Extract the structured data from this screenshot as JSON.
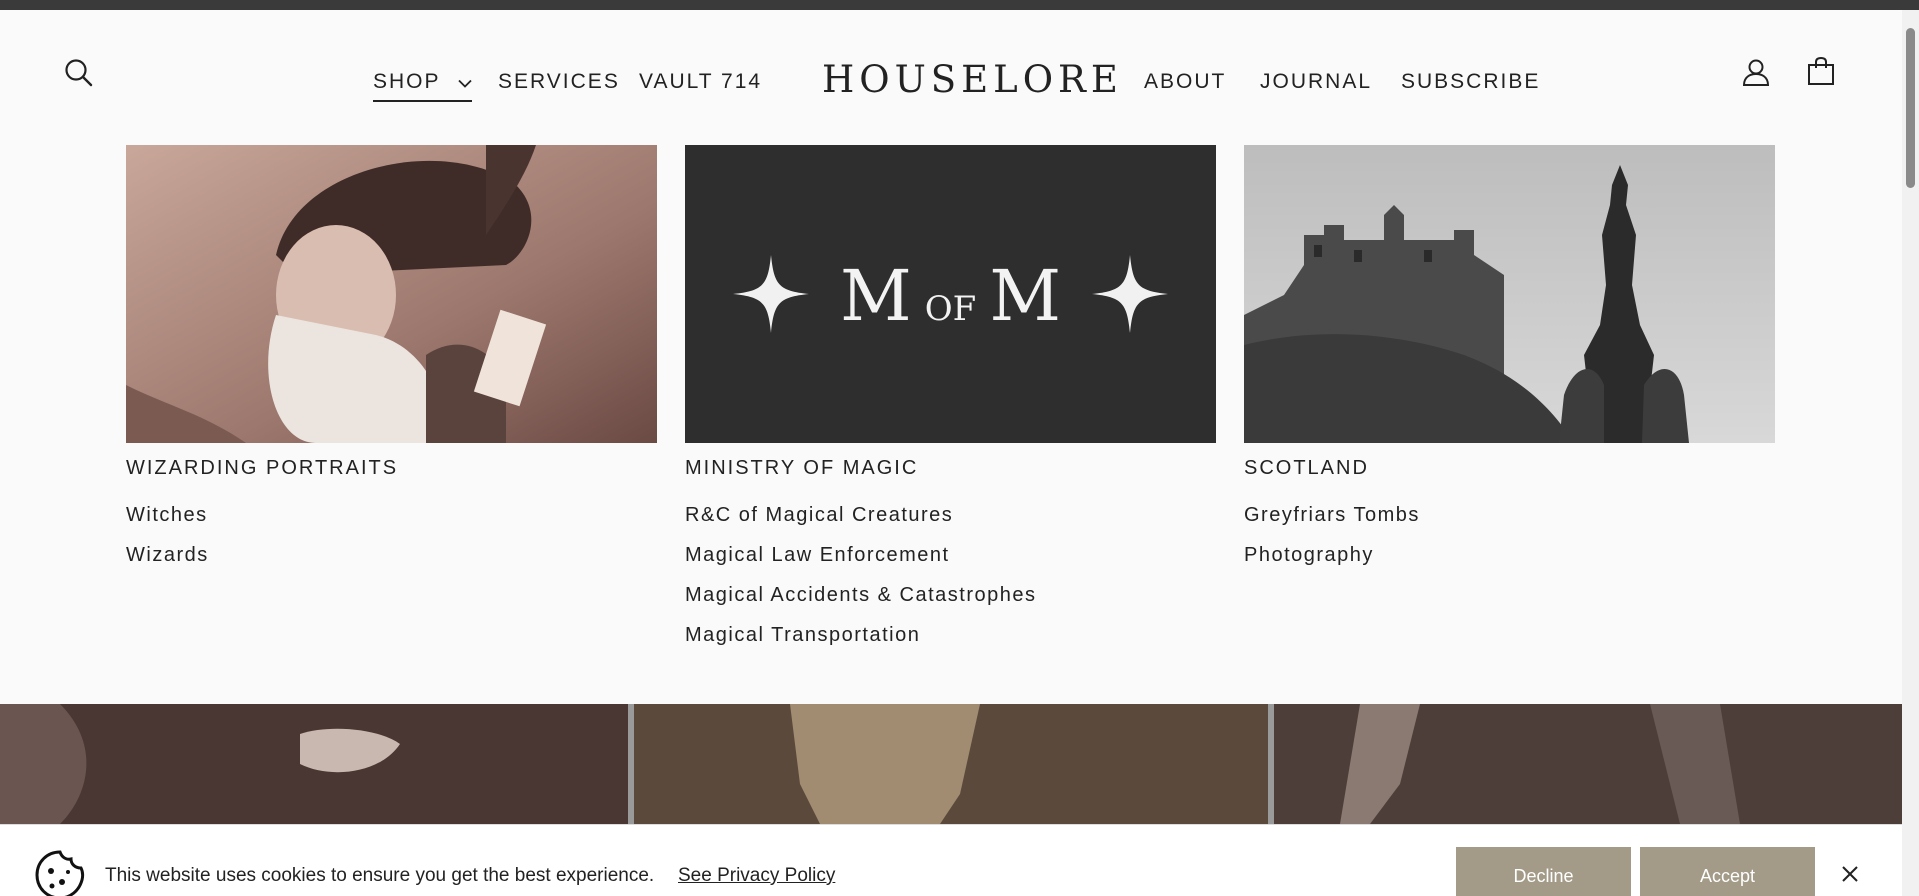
{
  "header": {
    "logo": "HOUSELORE",
    "nav_left": [
      {
        "label": "SHOP"
      },
      {
        "label": "SERVICES"
      },
      {
        "label": "VAULT 714"
      }
    ],
    "nav_right": [
      {
        "label": "ABOUT"
      },
      {
        "label": "JOURNAL"
      },
      {
        "label": "SUBSCRIBE"
      }
    ],
    "icons": [
      "search-icon",
      "account-icon",
      "cart-icon"
    ]
  },
  "mega_menu": {
    "columns": [
      {
        "title": "WIZARDING PORTRAITS",
        "links": [
          "Witches",
          "Wizards"
        ]
      },
      {
        "title": "MINISTRY OF MAGIC",
        "image_text": {
          "m1": "M",
          "of": "OF",
          "m2": "M"
        },
        "links": [
          "R&C of Magical Creatures",
          "Magical Law Enforcement",
          "Magical Accidents & Catastrophes",
          "Magical Transportation"
        ]
      },
      {
        "title": "SCOTLAND",
        "links": [
          "Greyfriars Tombs",
          "Photography"
        ]
      }
    ]
  },
  "cookie_banner": {
    "message": "This website uses cookies to ensure you get the best experience.",
    "privacy_link": "See Privacy Policy",
    "decline_label": "Decline",
    "accept_label": "Accept"
  },
  "colors": {
    "button_bg": "#a39a87",
    "dark_tile": "#2e2e2e",
    "text": "#222222"
  }
}
